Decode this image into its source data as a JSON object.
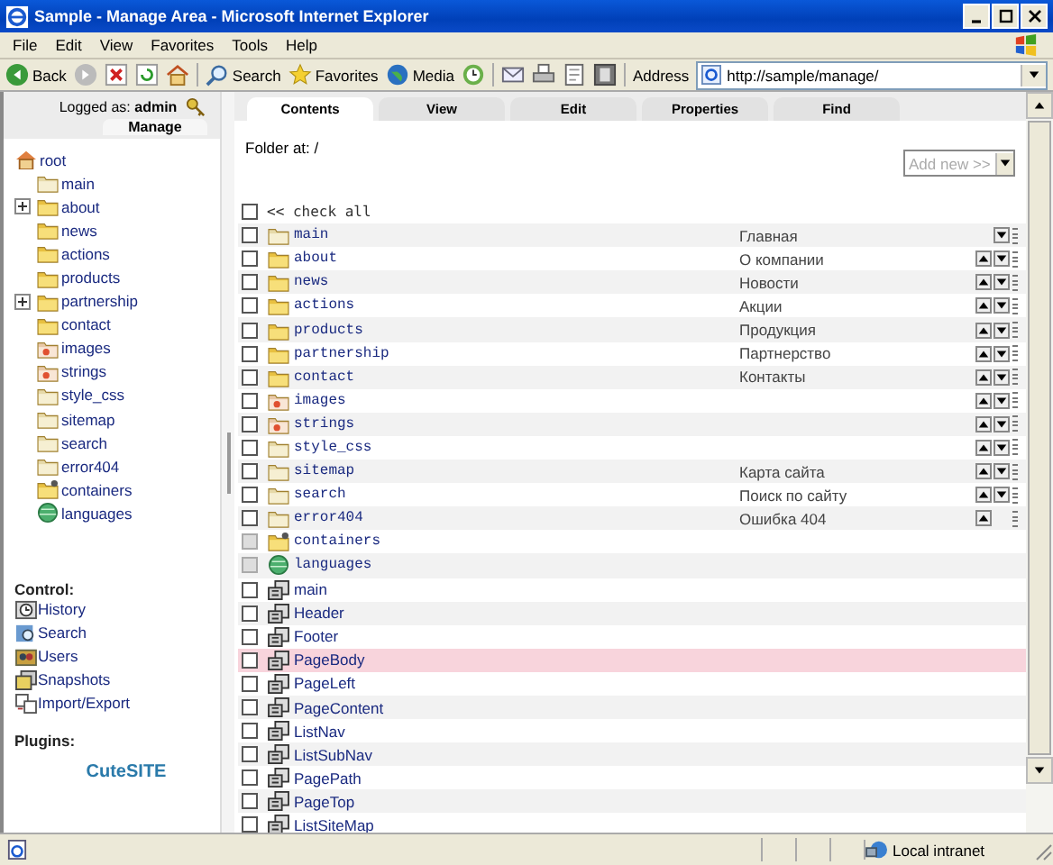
{
  "window": {
    "title": "Sample - Manage Area - Microsoft Internet Explorer"
  },
  "menu": [
    "File",
    "Edit",
    "View",
    "Favorites",
    "Tools",
    "Help"
  ],
  "toolbar": [
    {
      "kind": "back",
      "label": "Back"
    },
    {
      "kind": "forward"
    },
    {
      "kind": "stop"
    },
    {
      "kind": "refresh"
    },
    {
      "kind": "home"
    },
    {
      "kind": "search",
      "label": "Search"
    },
    {
      "kind": "favorites",
      "label": "Favorites"
    },
    {
      "kind": "media",
      "label": "Media"
    },
    {
      "kind": "history"
    },
    {
      "kind": "mail"
    },
    {
      "kind": "print"
    },
    {
      "kind": "edit"
    },
    {
      "kind": "discuss"
    }
  ],
  "address": {
    "label": "Address",
    "value": "http://sample/manage/"
  },
  "left_panel": {
    "logged_as": "Logged as:",
    "user": "admin",
    "manage_tab": "Manage",
    "tree": {
      "label": "root",
      "children": [
        {
          "label": "main",
          "kind": "folder-pale",
          "expandable": false
        },
        {
          "label": "about",
          "kind": "folder",
          "expandable": true
        },
        {
          "label": "news",
          "kind": "folder",
          "expandable": false
        },
        {
          "label": "actions",
          "kind": "folder",
          "expandable": false
        },
        {
          "label": "products",
          "kind": "folder",
          "expandable": false
        },
        {
          "label": "partnership",
          "kind": "folder",
          "expandable": true
        },
        {
          "label": "contact",
          "kind": "folder",
          "expandable": false
        },
        {
          "label": "images",
          "kind": "folder-special",
          "expandable": false
        },
        {
          "label": "strings",
          "kind": "folder-special",
          "expandable": false
        },
        {
          "label": "style_css",
          "kind": "folder-pale",
          "expandable": false
        },
        {
          "label": "sitemap",
          "kind": "folder-pale",
          "expandable": false
        },
        {
          "label": "search",
          "kind": "folder-pale",
          "expandable": false
        },
        {
          "label": "error404",
          "kind": "folder-pale",
          "expandable": false
        },
        {
          "label": "containers",
          "kind": "containers",
          "expandable": false
        },
        {
          "label": "languages",
          "kind": "globe",
          "expandable": false
        }
      ]
    },
    "control_heading": "Control:",
    "control_links": [
      {
        "label": "History",
        "kind": "history"
      },
      {
        "label": "Search",
        "kind": "search"
      },
      {
        "label": "Users",
        "kind": "users"
      },
      {
        "label": "Snapshots",
        "kind": "snapshots"
      },
      {
        "label": "Import/Export",
        "kind": "import"
      }
    ],
    "plugins_heading": "Plugins:",
    "logo": "Cute**SITE**"
  },
  "tabs": [
    {
      "label": "Contents",
      "selected": true
    },
    {
      "label": "View",
      "selected": false
    },
    {
      "label": "Edit",
      "selected": false
    },
    {
      "label": "Properties",
      "selected": false
    },
    {
      "label": "Find",
      "selected": false
    }
  ],
  "folder_at": "Folder at: /",
  "add_new": {
    "placeholder": "Add new >>",
    "disabled": true
  },
  "check_all": {
    "label": "<< check all",
    "checked": false
  },
  "rows": [
    {
      "kind": "folder-pale",
      "name": "main",
      "title": "Главная",
      "checked": false,
      "disabled": false,
      "selected": false,
      "move_up": false,
      "move_down": true
    },
    {
      "kind": "folder",
      "name": "about",
      "title": "О компании",
      "checked": false,
      "disabled": false,
      "selected": false,
      "move_up": true,
      "move_down": true
    },
    {
      "kind": "folder",
      "name": "news",
      "title": "Новости",
      "checked": false,
      "disabled": false,
      "selected": false,
      "move_up": true,
      "move_down": true
    },
    {
      "kind": "folder",
      "name": "actions",
      "title": "Акции",
      "checked": false,
      "disabled": false,
      "selected": false,
      "move_up": true,
      "move_down": true
    },
    {
      "kind": "folder",
      "name": "products",
      "title": "Продукция",
      "checked": false,
      "disabled": false,
      "selected": false,
      "move_up": true,
      "move_down": true
    },
    {
      "kind": "folder",
      "name": "partnership",
      "title": "Партнерство",
      "checked": false,
      "disabled": false,
      "selected": false,
      "move_up": true,
      "move_down": true
    },
    {
      "kind": "folder",
      "name": "contact",
      "title": "Контакты",
      "checked": false,
      "disabled": false,
      "selected": false,
      "move_up": true,
      "move_down": true
    },
    {
      "kind": "folder-special",
      "name": "images",
      "checked": false,
      "disabled": false,
      "selected": false,
      "move_up": true,
      "move_down": true
    },
    {
      "kind": "folder-special",
      "name": "strings",
      "checked": false,
      "disabled": false,
      "selected": false,
      "move_up": true,
      "move_down": true
    },
    {
      "kind": "folder-pale",
      "name": "style_css",
      "checked": false,
      "disabled": false,
      "selected": false,
      "move_up": true,
      "move_down": true
    },
    {
      "kind": "folder-pale",
      "name": "sitemap",
      "title": "Карта сайта",
      "checked": false,
      "disabled": false,
      "selected": false,
      "move_up": true,
      "move_down": true
    },
    {
      "kind": "folder-pale",
      "name": "search",
      "title": "Поиск по сайту",
      "checked": false,
      "disabled": false,
      "selected": false,
      "move_up": true,
      "move_down": true
    },
    {
      "kind": "folder-pale",
      "name": "error404",
      "title": "Ошибка 404",
      "checked": false,
      "disabled": false,
      "selected": false,
      "move_up": true,
      "move_down": false
    },
    {
      "kind": "containers",
      "name": "containers",
      "checked": false,
      "disabled": true,
      "selected": false,
      "move_up": false,
      "move_down": false
    },
    {
      "kind": "globe",
      "name": "languages",
      "checked": false,
      "disabled": true,
      "selected": false,
      "move_up": false,
      "move_down": false
    },
    {
      "kind": "block",
      "name": "main",
      "checked": false,
      "disabled": false,
      "selected": false,
      "move_up": false,
      "move_down": false
    },
    {
      "kind": "block",
      "name": "Header",
      "checked": false,
      "disabled": false,
      "selected": false,
      "move_up": false,
      "move_down": false
    },
    {
      "kind": "block",
      "name": "Footer",
      "checked": false,
      "disabled": false,
      "selected": false,
      "move_up": false,
      "move_down": false
    },
    {
      "kind": "block",
      "name": "PageBody",
      "checked": false,
      "disabled": false,
      "selected": true,
      "move_up": false,
      "move_down": false
    },
    {
      "kind": "block",
      "name": "PageLeft",
      "checked": false,
      "disabled": false,
      "selected": false,
      "move_up": false,
      "move_down": false
    },
    {
      "kind": "block",
      "name": "PageContent",
      "checked": false,
      "disabled": false,
      "selected": false,
      "move_up": false,
      "move_down": false
    },
    {
      "kind": "block",
      "name": "ListNav",
      "checked": false,
      "disabled": false,
      "selected": false,
      "move_up": false,
      "move_down": false
    },
    {
      "kind": "block",
      "name": "ListSubNav",
      "checked": false,
      "disabled": false,
      "selected": false,
      "move_up": false,
      "move_down": false
    },
    {
      "kind": "block",
      "name": "PagePath",
      "checked": false,
      "disabled": false,
      "selected": false,
      "move_up": false,
      "move_down": false
    },
    {
      "kind": "block",
      "name": "PageTop",
      "checked": false,
      "disabled": false,
      "selected": false,
      "move_up": false,
      "move_down": false
    },
    {
      "kind": "block",
      "name": "ListSiteMap",
      "checked": false,
      "disabled": false,
      "selected": false,
      "move_up": false,
      "move_down": false
    }
  ],
  "status_bar": {
    "zone": "Local intranet"
  }
}
